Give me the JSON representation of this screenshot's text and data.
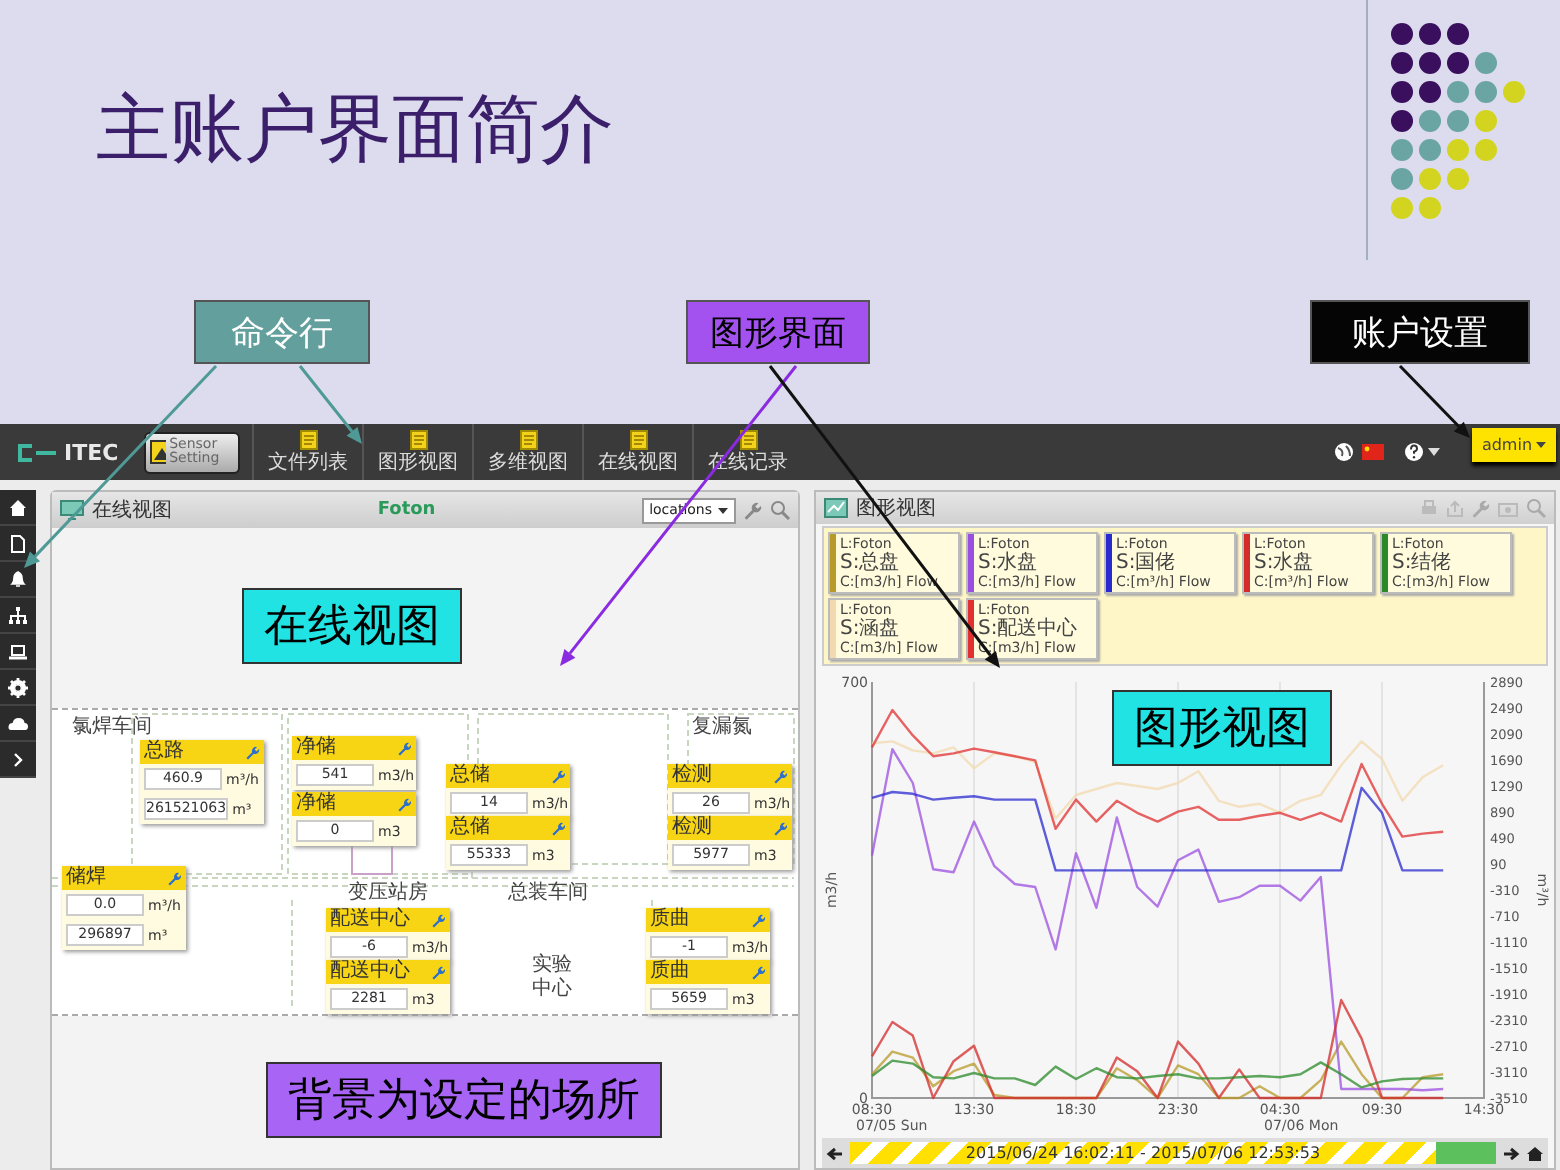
{
  "slide": {
    "title": "主账户界面简介"
  },
  "callouts": [
    {
      "text": "命令行",
      "color": "#63a09d",
      "kind": "light"
    },
    {
      "text": "图形界面",
      "color": "#a452ef",
      "kind": "dark"
    },
    {
      "text": "账户设置",
      "color": "#050505",
      "kind": "light"
    }
  ],
  "toolbar": {
    "logo": "ITEC",
    "sensor_button": "Sensor Setting",
    "tabs": [
      {
        "label": "文件列表",
        "selected": false
      },
      {
        "label": "图形视图",
        "selected": false
      },
      {
        "label": "多维视图",
        "selected": false
      },
      {
        "label": "在线视图",
        "selected": false
      },
      {
        "label": "在线记录",
        "selected": false
      }
    ],
    "user_menu": "admin"
  },
  "online_panel": {
    "title": "在线视图",
    "site": "Foton",
    "location_select": "locations",
    "overlay_label": "在线视图",
    "rooms": [
      "氯焊车间",
      "复漏氮",
      "变压站房",
      "总装车间",
      "实验中心"
    ],
    "meters": [
      {
        "title": "总路",
        "readings": [
          {
            "value": "460.9",
            "unit": "m³/h"
          },
          {
            "value": "261521063",
            "unit": "m³"
          }
        ]
      },
      {
        "title": "净储",
        "readings": [
          {
            "value": "541",
            "unit": "m3/h"
          }
        ]
      },
      {
        "title": "净储",
        "readings": [
          {
            "value": "0",
            "unit": "m3"
          }
        ]
      },
      {
        "title": "总储",
        "readings": [
          {
            "value": "14",
            "unit": "m3/h"
          }
        ]
      },
      {
        "title": "总储",
        "readings": [
          {
            "value": "55333",
            "unit": "m3"
          }
        ]
      },
      {
        "title": "检测",
        "readings": [
          {
            "value": "26",
            "unit": "m3/h"
          }
        ]
      },
      {
        "title": "检测",
        "readings": [
          {
            "value": "5977",
            "unit": "m3"
          }
        ]
      },
      {
        "title": "储焊",
        "readings": [
          {
            "value": "0.0",
            "unit": "m³/h"
          },
          {
            "value": "296897",
            "unit": "m³"
          }
        ]
      },
      {
        "title": "配送中心",
        "readings": [
          {
            "value": "-6",
            "unit": "m3/h"
          }
        ]
      },
      {
        "title": "配送中心",
        "readings": [
          {
            "value": "2281",
            "unit": "m3"
          }
        ]
      },
      {
        "title": "质曲",
        "readings": [
          {
            "value": "-1",
            "unit": "m3/h"
          }
        ]
      },
      {
        "title": "质曲",
        "readings": [
          {
            "value": "5659",
            "unit": "m3"
          }
        ]
      }
    ],
    "footer_label": "背景为设定的场所"
  },
  "graph_panel": {
    "title": "图形视图",
    "overlay_label": "图形视图",
    "chart_data": {
      "type": "line",
      "ylabel": "m3/h",
      "y2label": "m³/h",
      "categories": [
        "08:30",
        null,
        null,
        null,
        null,
        "13:30",
        null,
        null,
        null,
        null,
        "18:30",
        null,
        null,
        null,
        null,
        "23:30",
        null,
        null,
        null,
        null,
        "04:30",
        null,
        null,
        null,
        null,
        "09:30",
        null,
        null,
        null,
        null,
        "14:30"
      ],
      "ylim": [
        0,
        700
      ],
      "y2lim": [
        -3510,
        2890
      ],
      "grid": true,
      "yticks": [
        0,
        700
      ],
      "y2ticks": [
        2890,
        2490,
        2090,
        1690,
        1290,
        890,
        490,
        90,
        -310,
        -710,
        -1110,
        -1510,
        -1910,
        -2310,
        -2710,
        -3110,
        -3510
      ],
      "series": [
        {
          "color": "#b89a2a",
          "values": [
            40,
            78,
            68,
            20,
            45,
            58,
            5,
            0,
            0,
            0,
            0,
            0,
            50,
            30,
            0,
            55,
            40,
            0,
            0,
            20,
            0,
            0,
            30,
            95,
            40,
            0,
            0,
            35,
            40,
            null,
            null
          ]
        },
        {
          "color": "#9b4fe0",
          "values": [
            408,
            587,
            530,
            385,
            380,
            465,
            390,
            360,
            355,
            250,
            412,
            320,
            472,
            355,
            322,
            400,
            418,
            330,
            338,
            357,
            357,
            332,
            372,
            15,
            15,
            15,
            15,
            13,
            15,
            null,
            null
          ]
        },
        {
          "color": "#2a2ad0",
          "values": [
            505,
            515,
            512,
            502,
            505,
            508,
            502,
            502,
            502,
            383,
            383,
            383,
            383,
            383,
            383,
            383,
            383,
            383,
            383,
            383,
            383,
            383,
            383,
            383,
            522,
            480,
            383,
            383,
            383,
            null,
            null
          ]
        },
        {
          "color": "#d42a2a",
          "values": [
            70,
            128,
            105,
            0,
            62,
            88,
            0,
            0,
            0,
            0,
            0,
            0,
            68,
            45,
            0,
            95,
            58,
            0,
            48,
            0,
            0,
            0,
            0,
            165,
            100,
            0,
            0,
            0,
            0,
            null,
            null
          ]
        },
        {
          "color": "#2a8a2a",
          "values": [
            37,
            63,
            58,
            35,
            33,
            42,
            33,
            33,
            22,
            53,
            32,
            50,
            35,
            33,
            37,
            40,
            33,
            33,
            35,
            37,
            35,
            40,
            60,
            40,
            18,
            28,
            32,
            33,
            33,
            null,
            null
          ]
        },
        {
          "color": "#f3d9b0",
          "values": [
            597,
            600,
            585,
            580,
            590,
            555,
            580,
            575,
            565,
            470,
            510,
            520,
            530,
            525,
            520,
            530,
            550,
            500,
            490,
            495,
            480,
            500,
            510,
            560,
            600,
            570,
            500,
            540,
            560,
            null,
            null
          ]
        },
        {
          "color": "#e03030",
          "values": [
            590,
            653,
            610,
            575,
            580,
            588,
            582,
            575,
            568,
            453,
            502,
            465,
            500,
            480,
            465,
            482,
            490,
            468,
            468,
            475,
            480,
            468,
            480,
            465,
            562,
            495,
            440,
            445,
            448,
            null,
            null
          ]
        }
      ]
    },
    "date_labels": [
      "07/05 Sun",
      "07/06 Mon"
    ],
    "legend": [
      {
        "location": "L:Foton",
        "sensor": "S:总盘",
        "channel": "C:[m3/h] Flow",
        "color": "#b89a2a"
      },
      {
        "location": "L:Foton",
        "sensor": "S:水盘",
        "channel": "C:[m3/h] Flow",
        "color": "#9b4fe0"
      },
      {
        "location": "L:Foton",
        "sensor": "S:国佬",
        "channel": "C:[m³/h] Flow",
        "color": "#2a2ad0"
      },
      {
        "location": "L:Foton",
        "sensor": "S:水盘",
        "channel": "C:[m³/h] Flow",
        "color": "#d42a2a"
      },
      {
        "location": "L:Foton",
        "sensor": "S:结佬",
        "channel": "C:[m3/h] Flow",
        "color": "#2a8a2a"
      },
      {
        "location": "L:Foton",
        "sensor": "S:涵盘",
        "channel": "C:[m3/h] Flow",
        "color": "#f3d9b0"
      },
      {
        "location": "L:Foton",
        "sensor": "S:配送中心",
        "channel": "C:[m3/h] Flow",
        "color": "#e03030"
      }
    ],
    "timeline": {
      "range": "2015/06/24 16:02:11 - 2015/07/06 12:53:53"
    }
  }
}
